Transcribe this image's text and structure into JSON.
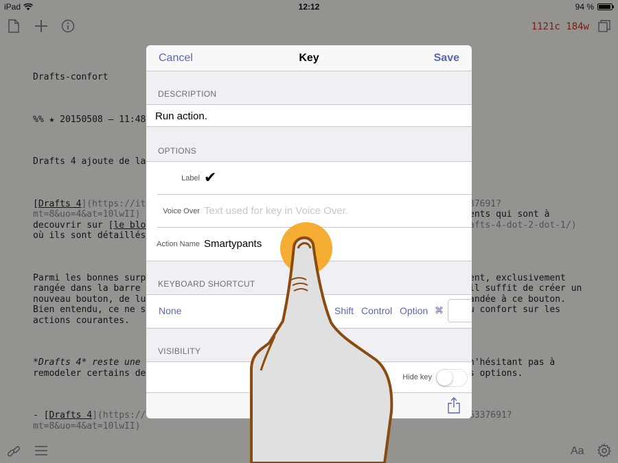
{
  "status_bar": {
    "device": "iPad",
    "time": "12:12",
    "battery": "94 %"
  },
  "toolbar": {
    "word_count": "1121c 184w"
  },
  "editor": {
    "line1": "Drafts-confort",
    "line2": "%% ★ 20150508 — 11:48",
    "line3": "Drafts 4 ajoute de la",
    "para1_a": "[",
    "para1_link": "Drafts 4",
    "para1_b": "](https://it",
    "para1_right1": "37691?",
    "para1_line2_left": "mt=8&uo=4&at=10lwII)",
    "para1_line2_right": "ents qui sont à",
    "para1_line3_left": "decouvrir sur [",
    "para1_line3_link": "le blo",
    "para1_line3_right": "afts-4-dot-2-dot-1/)",
    "para1_line4_left": "où ils sont détaillés",
    "para2_l1_left": "Parmi les bonnes surp",
    "para2_l1_right": "ent, exclusivement",
    "para2_l2_left": "rangée dans la barre",
    "para2_l2_right": "il suffit de créer un",
    "para2_l3_left": "nouveau bouton, de lu",
    "para2_l3_right": "andée à ce bouton.",
    "para2_l4_left": "Bien entendu, ce ne s",
    "para2_l4_right": "u confort sur les",
    "para2_l5": "actions courantes.",
    "para3_l1_left": "*Drafts 4* reste une",
    "para3_l1_right": "n'hésitant pas à",
    "para3_l2_left": "remodeler certains de",
    "para3_l2_right": "s options.",
    "para4_a": "- [",
    "para4_link": "Drafts 4",
    "para4_b": "](https://",
    "para4_right": "6337691?",
    "para4_l2": "mt=8&uo=4&at=10lwII)"
  },
  "modal": {
    "cancel": "Cancel",
    "title": "Key",
    "save": "Save",
    "description_header": "DESCRIPTION",
    "description_value": "Run action.",
    "options_header": "OPTIONS",
    "label_label": "Label",
    "label_check": "✔",
    "voiceover_label": "Voice Over",
    "voiceover_placeholder": "Text used for key in Voice Over.",
    "action_name_label": "Action Name",
    "action_name_value": "Smartypants",
    "keyboard_header": "KEYBOARD SHORTCUT",
    "ks_none": "None",
    "ks_shift": "Shift",
    "ks_control": "Control",
    "ks_option": "Option",
    "ks_cmd": "⌘",
    "visibility_header": "VISIBILITY",
    "hide_key_label": "Hide key",
    "hide_key_on": false
  },
  "bottom_toolbar": {
    "font_label": "Aa"
  },
  "colors": {
    "accent": "#5a66b8",
    "word_count": "#c0392b",
    "touch": "#f5a623",
    "finger_outline": "#8b4a10"
  }
}
